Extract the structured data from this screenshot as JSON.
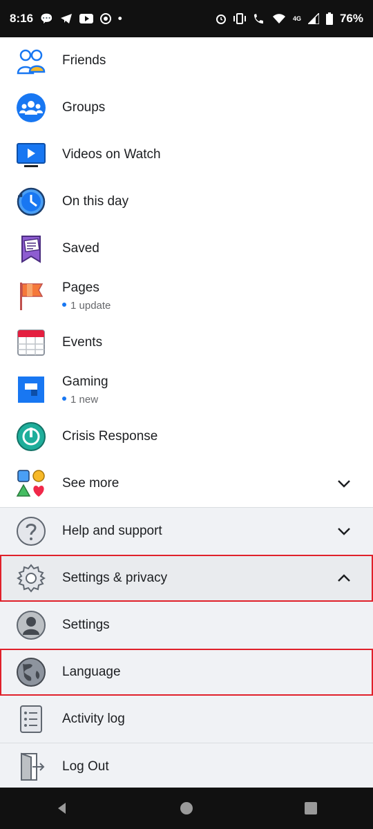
{
  "status_bar": {
    "time": "8:16",
    "battery": "76%",
    "network": "4G",
    "left_icons": [
      "messenger-icon",
      "telegram-icon",
      "youtube-icon",
      "chrome-icon",
      "dot-icon"
    ],
    "right_icons": [
      "alarm-icon",
      "vibrate-icon",
      "wifi-call-icon",
      "wifi-icon",
      "signal-icon",
      "battery-icon"
    ]
  },
  "menu": {
    "shortcuts": [
      {
        "label": "Friends",
        "icon": "friends-icon"
      },
      {
        "label": "Groups",
        "icon": "groups-icon"
      },
      {
        "label": "Videos on Watch",
        "icon": "watch-icon"
      },
      {
        "label": "On this day",
        "icon": "memories-icon"
      },
      {
        "label": "Saved",
        "icon": "saved-icon"
      },
      {
        "label": "Pages",
        "icon": "pages-icon",
        "sub": "1 update"
      },
      {
        "label": "Events",
        "icon": "events-icon"
      },
      {
        "label": "Gaming",
        "icon": "gaming-icon",
        "sub": "1 new"
      },
      {
        "label": "Crisis Response",
        "icon": "crisis-response-icon"
      },
      {
        "label": "See more",
        "icon": "see-more-icon"
      }
    ],
    "help": {
      "label": "Help and support",
      "icon": "help-icon"
    },
    "settings_privacy": {
      "label": "Settings & privacy",
      "icon": "gear-icon"
    },
    "settings_items": [
      {
        "label": "Settings",
        "icon": "profile-icon"
      },
      {
        "label": "Language",
        "icon": "globe-icon"
      },
      {
        "label": "Activity log",
        "icon": "activity-log-icon"
      }
    ],
    "logout": {
      "label": "Log Out",
      "icon": "logout-icon"
    }
  },
  "colors": {
    "accent": "#1877f2",
    "highlight": "#e0202a"
  }
}
